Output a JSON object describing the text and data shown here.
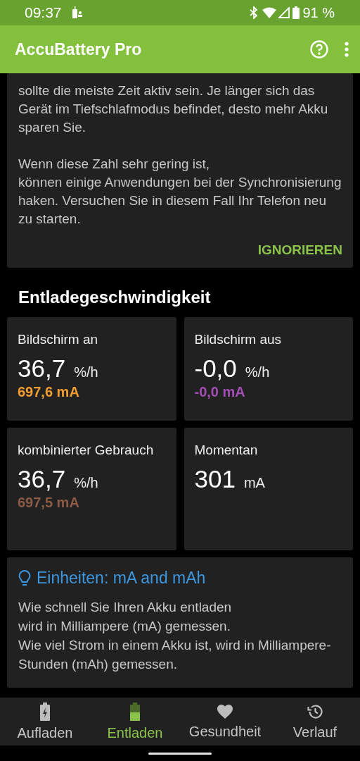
{
  "status_bar": {
    "time": "09:37",
    "battery": "91 %"
  },
  "app_bar": {
    "title": "AccuBattery Pro"
  },
  "notice": {
    "paragraphs": [
      "sollte die meiste Zeit aktiv sein. Je länger sich das Gerät im Tiefschlafmodus befindet, desto mehr Akku sparen Sie.",
      "Wenn diese Zahl sehr gering ist,\nkönnen einige Anwendungen bei der Synchronisierung haken. Versuchen Sie in diesem Fall Ihr Telefon neu zu starten."
    ],
    "action": "IGNORIEREN"
  },
  "section_title": "Entladegeschwindigkeit",
  "cards": [
    {
      "label": "Bildschirm an",
      "value": "36,7",
      "unit": "%/h",
      "sub_value": "697,6 mA",
      "color": "#f39c2f"
    },
    {
      "label": "Bildschirm aus",
      "value": "-0,0",
      "unit": "%/h",
      "sub_value": "-0,0 mA",
      "color": "#a34db5"
    },
    {
      "label": "kombinierter Gebrauch",
      "value": "36,7",
      "unit": "%/h",
      "sub_value": "697,5 mA",
      "color": "#8d5a45"
    },
    {
      "label": "Momentan",
      "value": "301",
      "unit": "mA"
    }
  ],
  "info": {
    "title": "Einheiten: mA and mAh",
    "text": "Wie schnell Sie Ihren Akku entladen\nwird in Milliampere (mA) gemessen.\nWie viel Strom in einem Akku ist, wird in Milliampere-Stunden (mAh) gemessen."
  },
  "bottom_nav": [
    {
      "kind": "charging",
      "label": "Aufladen",
      "selected": false
    },
    {
      "kind": "discharging",
      "label": "Entladen",
      "selected": true
    },
    {
      "kind": "health",
      "label": "Gesundheit",
      "selected": false
    },
    {
      "kind": "history",
      "label": "Verlauf",
      "selected": false
    }
  ]
}
